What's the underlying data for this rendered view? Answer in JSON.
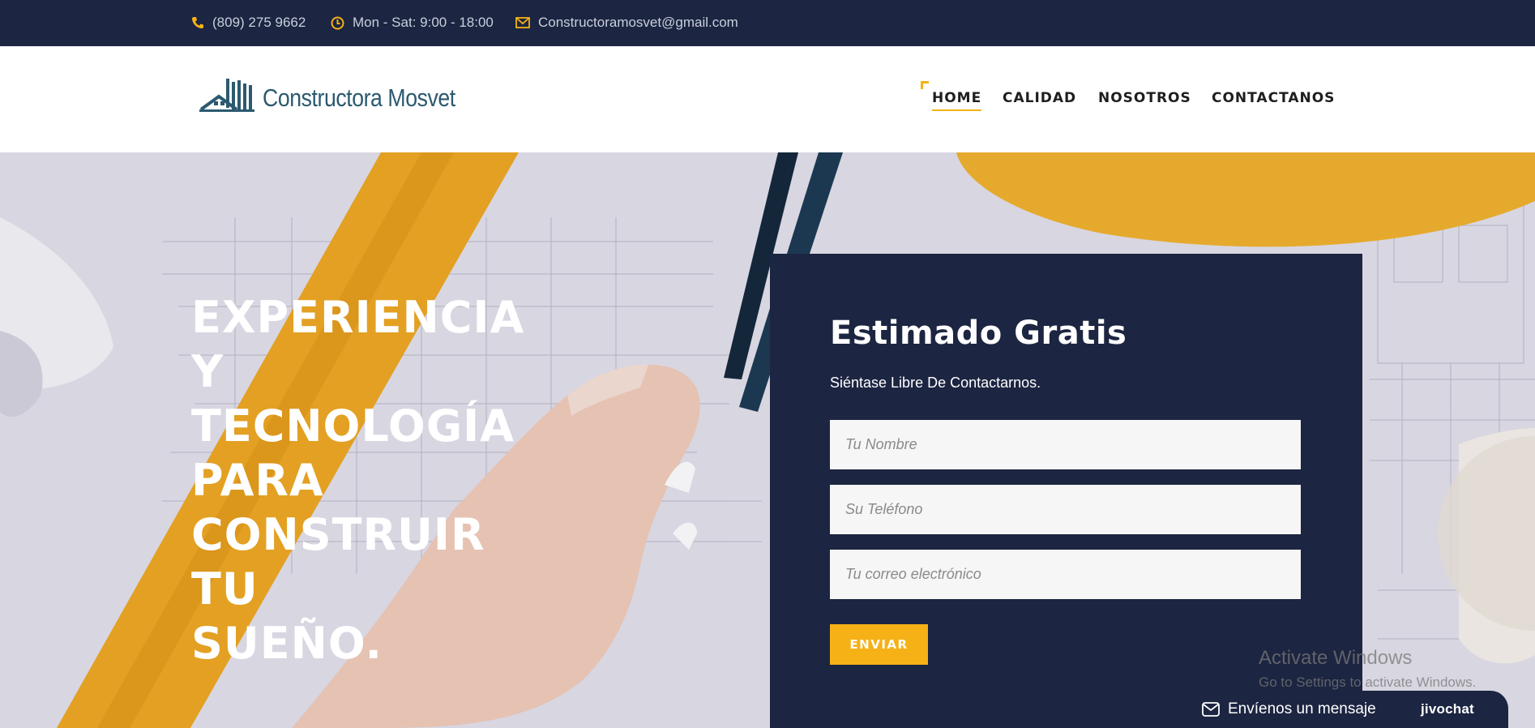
{
  "topbar": {
    "phone": "(809) 275 9662",
    "hours": "Mon - Sat: 9:00 - 18:00",
    "email": "Constructoramosvet@gmail.com",
    "icons": [
      "phone-icon",
      "clock-icon",
      "envelope-icon"
    ],
    "icon_color": "#f5b115"
  },
  "header": {
    "logo_text": "Constructora Mosvet",
    "nav": [
      {
        "label": "HOME",
        "active": true
      },
      {
        "label": "CALIDAD",
        "active": false
      },
      {
        "label": "NOSOTROS",
        "active": false
      },
      {
        "label": "CONTACTANOS",
        "active": false
      }
    ]
  },
  "hero": {
    "title_lines": [
      "EXPERIENCIA",
      "Y",
      "TECNOLOGÍA",
      "PARA",
      "CONSTRUIR",
      "TU",
      "SUEÑO."
    ]
  },
  "form": {
    "title": "Estimado Gratis",
    "subtitle": "Siéntase Libre De Contactarnos.",
    "fields": [
      {
        "placeholder": "Tu Nombre",
        "value": ""
      },
      {
        "placeholder": "Su Teléfono",
        "value": ""
      },
      {
        "placeholder": "Tu correo electrónico",
        "value": ""
      }
    ],
    "submit_label": "ENVIAR"
  },
  "watermark": {
    "line1": "Activate Windows",
    "line2": "Go to Settings to activate Windows."
  },
  "chat": {
    "label": "Envíenos un mensaje",
    "brand": "jivochat"
  },
  "colors": {
    "navy": "#1c2541",
    "accent": "#f5b115",
    "white": "#ffffff"
  }
}
